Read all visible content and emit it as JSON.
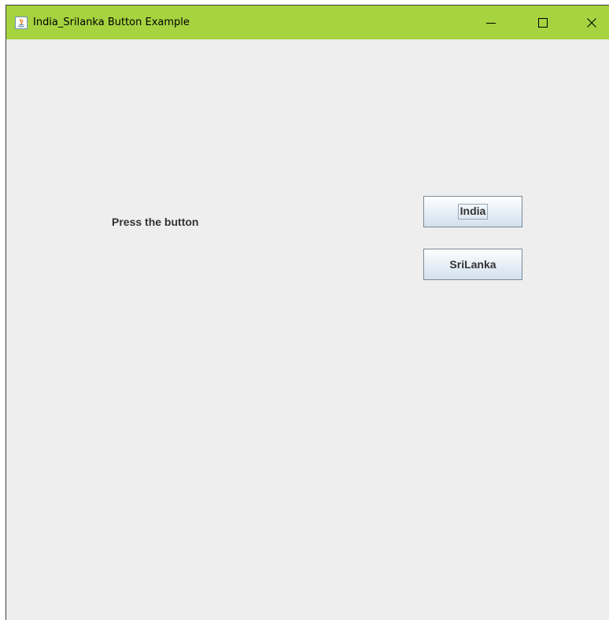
{
  "window": {
    "title": "India_Srilanka Button Example",
    "titlebar_color": "#a6d33f",
    "background_color": "#eeeeee"
  },
  "titlebar_buttons": {
    "minimize_icon": "minimize-icon",
    "maximize_icon": "maximize-icon",
    "close_icon": "close-icon"
  },
  "content": {
    "label": "Press the button",
    "buttons": [
      {
        "label": "India",
        "focused": true
      },
      {
        "label": "SriLanka",
        "focused": false
      }
    ]
  }
}
